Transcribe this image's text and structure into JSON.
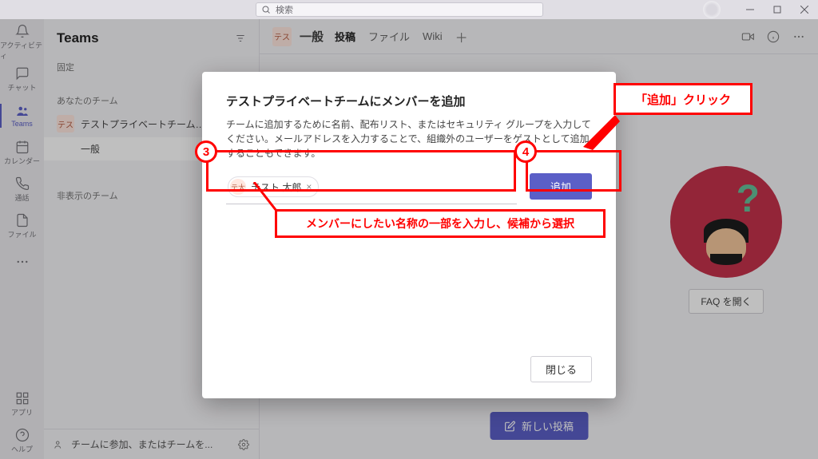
{
  "titlebar": {
    "search_placeholder": "検索"
  },
  "rail": {
    "activity": "アクティビティ",
    "chat": "チャット",
    "teams": "Teams",
    "calendar": "カレンダー",
    "calls": "通話",
    "files": "ファイル",
    "apps": "アプリ",
    "help": "ヘルプ"
  },
  "channels": {
    "title": "Teams",
    "pinned": "固定",
    "your_teams": "あなたのチーム",
    "team_badge": "テス",
    "team_name": "テストプライベートチーム…",
    "channel_general": "一般",
    "hidden": "非表示のチーム",
    "join_create": "チームに参加、またはチームを..."
  },
  "chead": {
    "badge": "テス",
    "name": "一般",
    "tab_posts": "投稿",
    "tab_files": "ファイル",
    "tab_wiki": "Wiki"
  },
  "faq_button": "FAQ を開く",
  "new_post": "新しい投稿",
  "modal": {
    "title": "テストプライベートチームにメンバーを追加",
    "desc": "チームに追加するために名前、配布リスト、またはセキュリティ グループを入力してください。メールアドレスを入力することで、組織外のユーザーをゲストとして追加することもできます。",
    "chip_badge": "テ太",
    "chip_name": "テスト 太郎",
    "add": "追加",
    "close": "閉じる"
  },
  "annotations": {
    "num3": "3",
    "num4": "4",
    "note_add": "「追加」クリック",
    "note_input": "メンバーにしたい名称の一部を入力し、候補から選択"
  }
}
